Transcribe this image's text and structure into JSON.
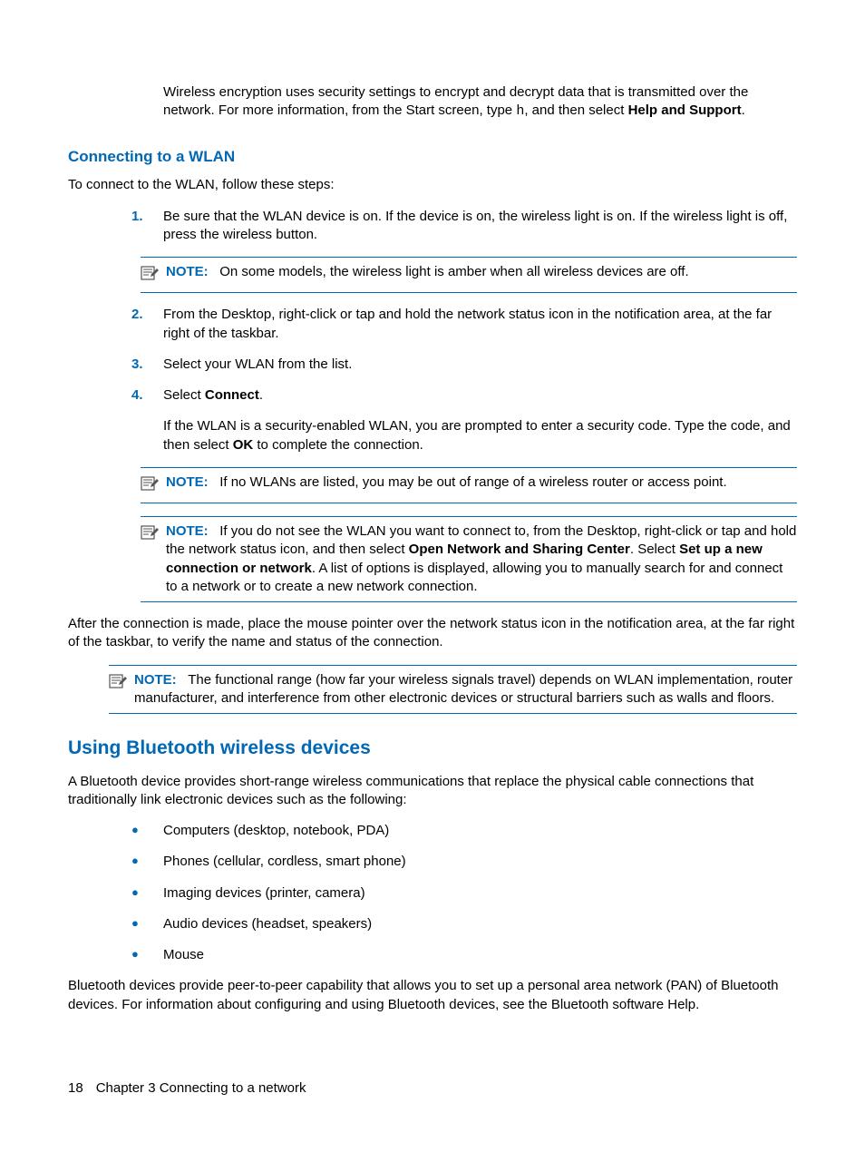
{
  "intro": {
    "p1a": "Wireless encryption uses security settings to encrypt and decrypt data that is transmitted over the network. For more information, from the Start screen, type ",
    "p1_mono": "h",
    "p1b": ", and then select ",
    "p1_bold": "Help and Support",
    "p1c": "."
  },
  "section1": {
    "heading": "Connecting to a WLAN",
    "p1": "To connect to the WLAN, follow these steps:",
    "steps": {
      "s1_num": "1.",
      "s1": "Be sure that the WLAN device is on. If the device is on, the wireless light is on. If the wireless light is off, press the wireless button.",
      "s2_num": "2.",
      "s2": "From the Desktop, right-click or tap and hold the network status icon in the notification area, at the far right of the taskbar.",
      "s3_num": "3.",
      "s3": "Select your WLAN from the list.",
      "s4_num": "4.",
      "s4a": "Select ",
      "s4_bold": "Connect",
      "s4b": ".",
      "s4_p2a": "If the WLAN is a security-enabled WLAN, you are prompted to enter a security code. Type the code, and then select ",
      "s4_p2_bold": "OK",
      "s4_p2b": " to complete the connection."
    },
    "note1": {
      "label": "NOTE:",
      "text": "On some models, the wireless light is amber when all wireless devices are off."
    },
    "note2": {
      "label": "NOTE:",
      "text": "If no WLANs are listed, you may be out of range of a wireless router or access point."
    },
    "note3": {
      "label": "NOTE:",
      "a": "If you do not see the WLAN you want to connect to, from the Desktop, right-click or tap and hold the network status icon, and then select ",
      "bold1": "Open Network and Sharing Center",
      "b": ". Select ",
      "bold2": "Set up a new connection or network",
      "c": ". A list of options is displayed, allowing you to manually search for and connect to a network or to create a new network connection."
    },
    "p_after": "After the connection is made, place the mouse pointer over the network status icon in the notification area, at the far right of the taskbar, to verify the name and status of the connection.",
    "note4": {
      "label": "NOTE:",
      "text": "The functional range (how far your wireless signals travel) depends on WLAN implementation, router manufacturer, and interference from other electronic devices or structural barriers such as walls and floors."
    }
  },
  "section2": {
    "heading": "Using Bluetooth wireless devices",
    "p1": "A Bluetooth device provides short-range wireless communications that replace the physical cable connections that traditionally link electronic devices such as the following:",
    "bullets": {
      "b1": "Computers (desktop, notebook, PDA)",
      "b2": "Phones (cellular, cordless, smart phone)",
      "b3": "Imaging devices (printer, camera)",
      "b4": "Audio devices (headset, speakers)",
      "b5": "Mouse"
    },
    "p2": "Bluetooth devices provide peer-to-peer capability that allows you to set up a personal area network (PAN) of Bluetooth devices. For information about configuring and using Bluetooth devices, see the Bluetooth software Help."
  },
  "footer": {
    "page": "18",
    "chapter": "Chapter 3   Connecting to a network"
  },
  "glyphs": {
    "bullet": "●"
  }
}
